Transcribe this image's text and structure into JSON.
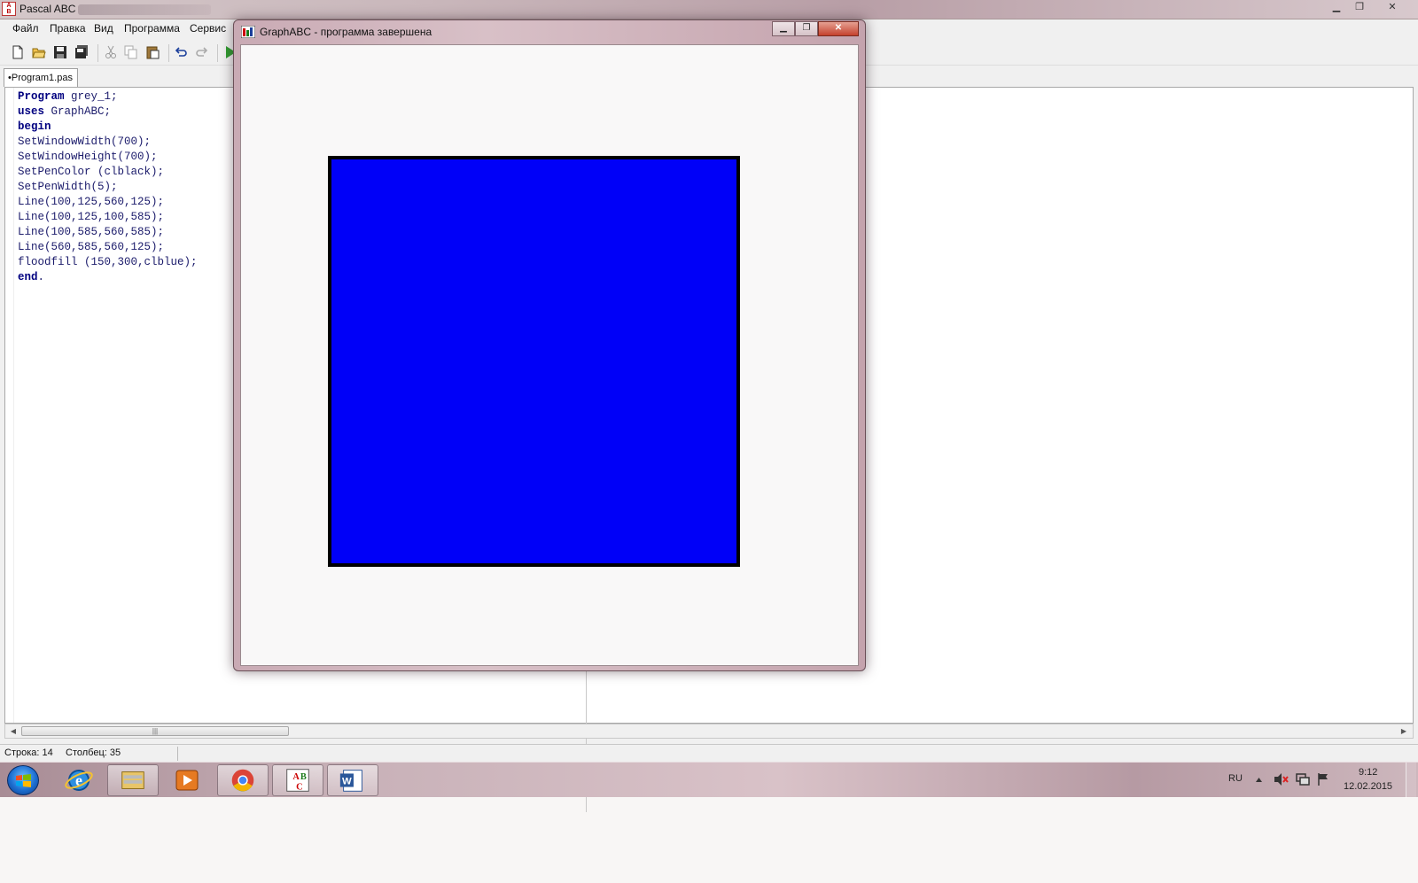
{
  "ide": {
    "title": "Pascal ABC",
    "menu": [
      "Файл",
      "Правка",
      "Вид",
      "Программа",
      "Сервис"
    ],
    "tab_label": "•Program1.pas",
    "code_lines": [
      {
        "kw": "Program",
        "rest": " grey_1;"
      },
      {
        "kw": "uses",
        "rest": " GraphABC;"
      },
      {
        "kw": "begin",
        "rest": ""
      },
      {
        "kw": "",
        "rest": "SetWindowWidth(700);"
      },
      {
        "kw": "",
        "rest": "SetWindowHeight(700);"
      },
      {
        "kw": "",
        "rest": "SetPenColor (clblack);"
      },
      {
        "kw": "",
        "rest": "SetPenWidth(5);"
      },
      {
        "kw": "",
        "rest": "Line(100,125,560,125);"
      },
      {
        "kw": "",
        "rest": "Line(100,125,100,585);"
      },
      {
        "kw": "",
        "rest": "Line(100,585,560,585);"
      },
      {
        "kw": "",
        "rest": "Line(560,585,560,125);"
      },
      {
        "kw": "",
        "rest": "floodfill (150,300,clblue);"
      },
      {
        "kw": "end",
        "rest": "."
      }
    ],
    "status": {
      "line": "Строка: 14",
      "column": "Столбец: 35"
    }
  },
  "graph_window": {
    "title": "GraphABC - программа завершена",
    "fill_color": "#0000f8",
    "pen_color": "#000000"
  },
  "taskbar": {
    "language": "RU",
    "time": "9:12",
    "date": "12.02.2015",
    "icons": [
      "windows-start-icon",
      "internet-explorer-icon",
      "file-explorer-icon",
      "media-player-icon",
      "chrome-icon",
      "pascal-abc-icon",
      "word-icon"
    ]
  }
}
